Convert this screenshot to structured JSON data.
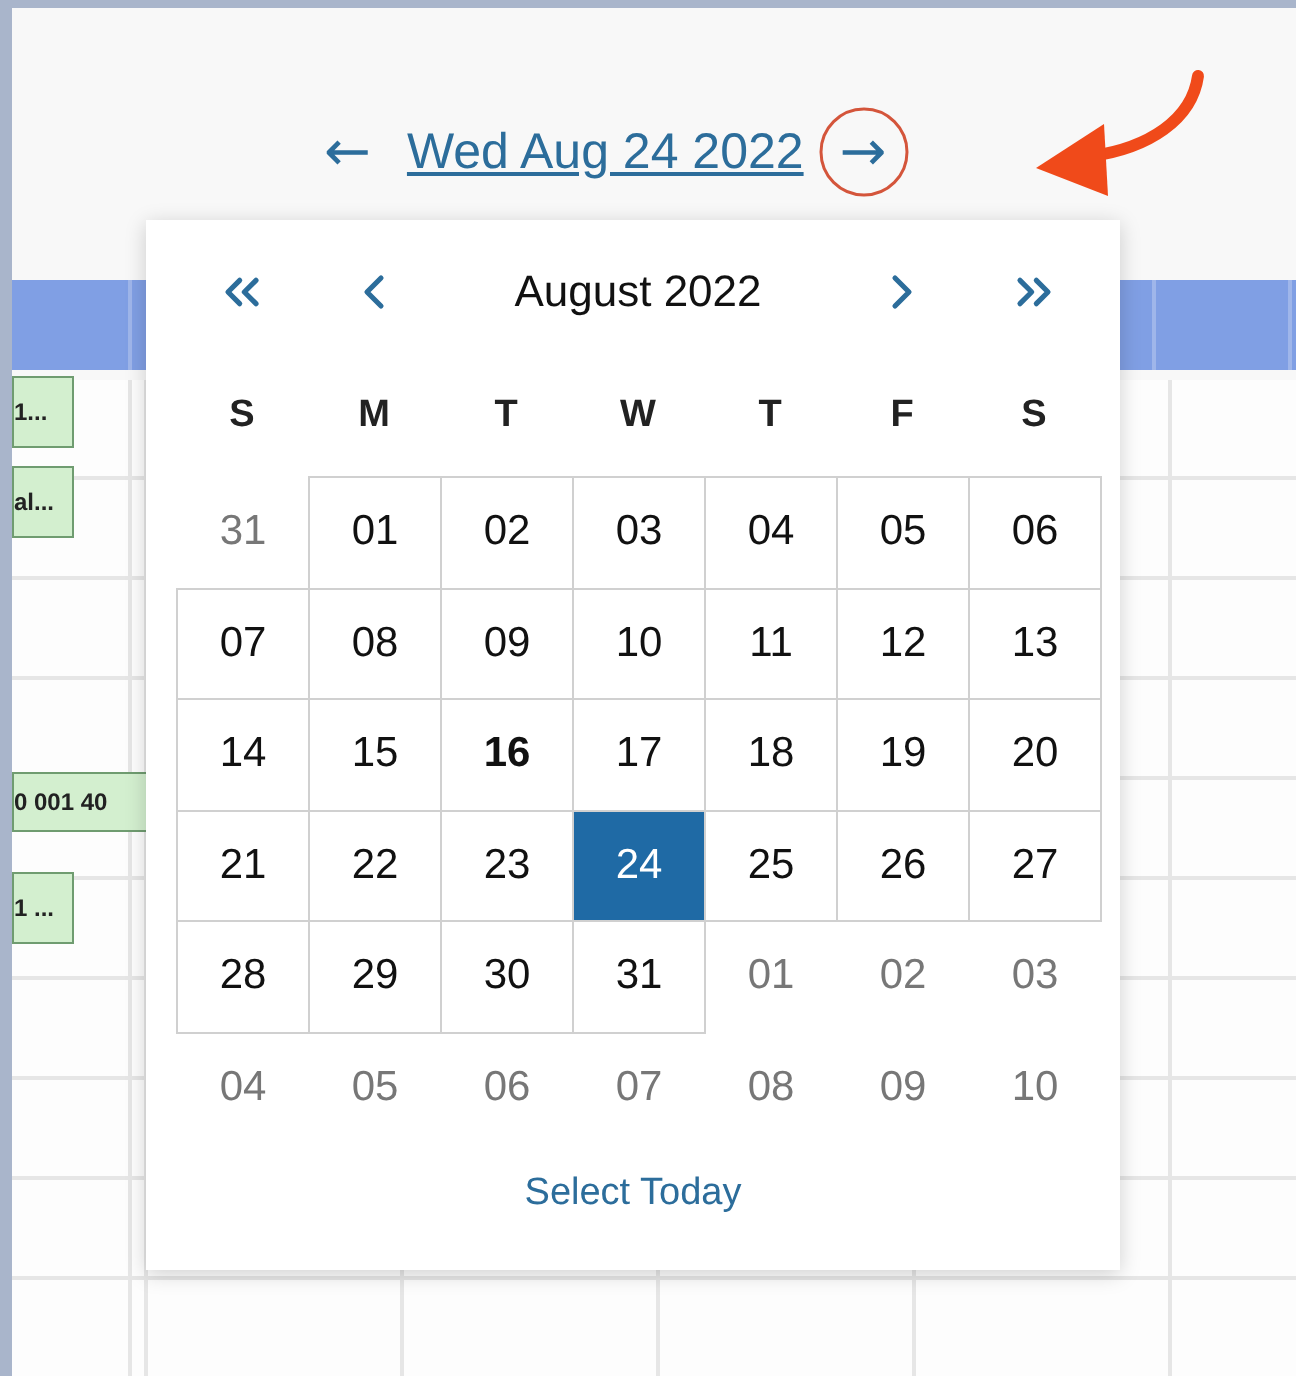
{
  "date_nav": {
    "prev": "←",
    "date": "Wed Aug 24 2022",
    "next": "→",
    "next_highlighted": true
  },
  "schedule": {
    "events": [
      {
        "label": "1...",
        "kind": "chip"
      },
      {
        "label": "al...",
        "kind": "chip"
      },
      {
        "label": "0 001 40",
        "kind": "wide"
      },
      {
        "label": "1 ...",
        "kind": "chip"
      }
    ]
  },
  "date_picker": {
    "month": "August 2022",
    "weekdays": [
      "S",
      "M",
      "T",
      "W",
      "T",
      "F",
      "S"
    ],
    "days": [
      {
        "label": "31",
        "kind": "outside",
        "today": false,
        "selected": false
      },
      {
        "label": "01",
        "kind": "current",
        "today": false,
        "selected": false
      },
      {
        "label": "02",
        "kind": "current",
        "today": false,
        "selected": false
      },
      {
        "label": "03",
        "kind": "current",
        "today": false,
        "selected": false
      },
      {
        "label": "04",
        "kind": "current",
        "today": false,
        "selected": false
      },
      {
        "label": "05",
        "kind": "current",
        "today": false,
        "selected": false
      },
      {
        "label": "06",
        "kind": "current",
        "today": false,
        "selected": false
      },
      {
        "label": "07",
        "kind": "current",
        "today": false,
        "selected": false
      },
      {
        "label": "08",
        "kind": "current",
        "today": false,
        "selected": false
      },
      {
        "label": "09",
        "kind": "current",
        "today": false,
        "selected": false
      },
      {
        "label": "10",
        "kind": "current",
        "today": false,
        "selected": false
      },
      {
        "label": "11",
        "kind": "current",
        "today": false,
        "selected": false
      },
      {
        "label": "12",
        "kind": "current",
        "today": false,
        "selected": false
      },
      {
        "label": "13",
        "kind": "current",
        "today": false,
        "selected": false
      },
      {
        "label": "14",
        "kind": "current",
        "today": false,
        "selected": false
      },
      {
        "label": "15",
        "kind": "current",
        "today": false,
        "selected": false
      },
      {
        "label": "16",
        "kind": "current",
        "today": true,
        "selected": false
      },
      {
        "label": "17",
        "kind": "current",
        "today": false,
        "selected": false
      },
      {
        "label": "18",
        "kind": "current",
        "today": false,
        "selected": false
      },
      {
        "label": "19",
        "kind": "current",
        "today": false,
        "selected": false
      },
      {
        "label": "20",
        "kind": "current",
        "today": false,
        "selected": false
      },
      {
        "label": "21",
        "kind": "current",
        "today": false,
        "selected": false
      },
      {
        "label": "22",
        "kind": "current",
        "today": false,
        "selected": false
      },
      {
        "label": "23",
        "kind": "current",
        "today": false,
        "selected": false
      },
      {
        "label": "24",
        "kind": "current",
        "today": false,
        "selected": true
      },
      {
        "label": "25",
        "kind": "current",
        "today": false,
        "selected": false
      },
      {
        "label": "26",
        "kind": "current",
        "today": false,
        "selected": false
      },
      {
        "label": "27",
        "kind": "current",
        "today": false,
        "selected": false
      },
      {
        "label": "28",
        "kind": "current",
        "today": false,
        "selected": false
      },
      {
        "label": "29",
        "kind": "current",
        "today": false,
        "selected": false
      },
      {
        "label": "30",
        "kind": "current",
        "today": false,
        "selected": false
      },
      {
        "label": "31",
        "kind": "current",
        "today": false,
        "selected": false
      },
      {
        "label": "01",
        "kind": "outside",
        "today": false,
        "selected": false
      },
      {
        "label": "02",
        "kind": "outside",
        "today": false,
        "selected": false
      },
      {
        "label": "03",
        "kind": "outside",
        "today": false,
        "selected": false
      },
      {
        "label": "04",
        "kind": "outside",
        "today": false,
        "selected": false
      },
      {
        "label": "05",
        "kind": "outside",
        "today": false,
        "selected": false
      },
      {
        "label": "06",
        "kind": "outside",
        "today": false,
        "selected": false
      },
      {
        "label": "07",
        "kind": "outside",
        "today": false,
        "selected": false
      },
      {
        "label": "08",
        "kind": "outside",
        "today": false,
        "selected": false
      },
      {
        "label": "09",
        "kind": "outside",
        "today": false,
        "selected": false
      },
      {
        "label": "10",
        "kind": "outside",
        "today": false,
        "selected": false
      }
    ],
    "footer": "Select Today"
  }
}
